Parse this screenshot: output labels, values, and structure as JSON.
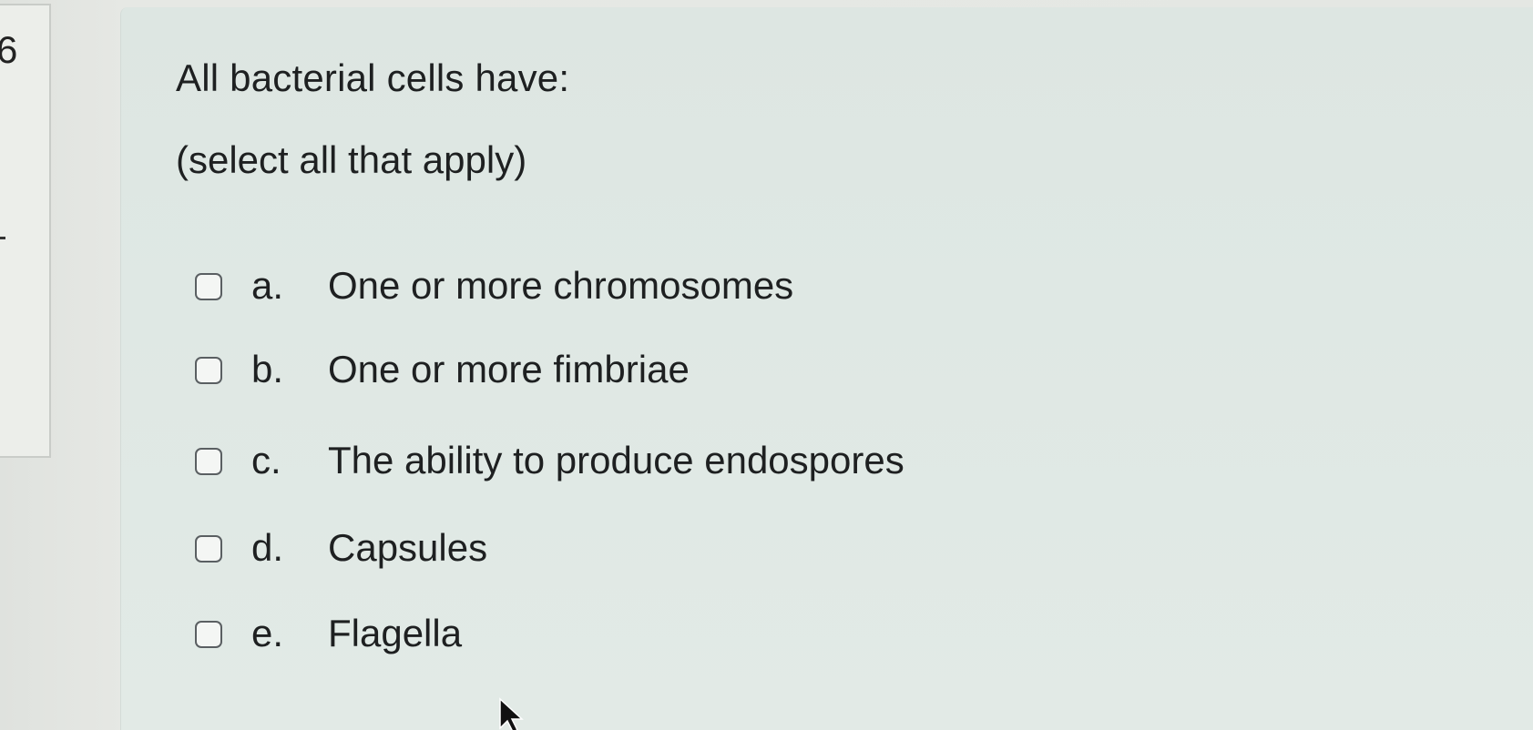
{
  "sidebar": {
    "number": "6"
  },
  "question": {
    "title": "All bacterial cells have:",
    "instruction": "(select all that apply)"
  },
  "options": [
    {
      "letter": "a.",
      "label": "One or more chromosomes",
      "checked": false
    },
    {
      "letter": "b.",
      "label": "One or more fimbriae",
      "checked": false
    },
    {
      "letter": "c.",
      "label": "The ability to produce endospores",
      "checked": false
    },
    {
      "letter": "d.",
      "label": "Capsules",
      "checked": false
    },
    {
      "letter": "e.",
      "label": "Flagella",
      "checked": false
    }
  ],
  "icons": {
    "cursor": "mouse-pointer-icon",
    "checkbox": "checkbox-icon"
  },
  "colors": {
    "text": "#1e2021",
    "panel_bg": "#dfe8e4",
    "checkbox_border": "#5a5f62"
  }
}
